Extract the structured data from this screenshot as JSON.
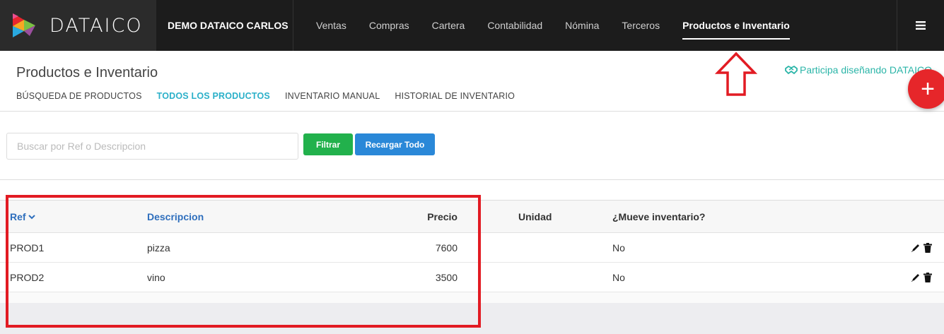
{
  "header": {
    "brand": "DATAICO",
    "company": "DEMO DATAICO CARLOS",
    "nav": [
      {
        "label": "Ventas"
      },
      {
        "label": "Compras"
      },
      {
        "label": "Cartera"
      },
      {
        "label": "Contabilidad"
      },
      {
        "label": "Nómina"
      },
      {
        "label": "Terceros"
      },
      {
        "label": "Productos e Inventario",
        "active": true
      }
    ],
    "menu_icon": "hamburger-icon"
  },
  "page": {
    "title": "Productos e Inventario",
    "participa": "Participa diseñando DATAICO",
    "tabs": [
      {
        "label": "BÚSQUEDA DE PRODUCTOS"
      },
      {
        "label": "TODOS LOS PRODUCTOS",
        "active": true
      },
      {
        "label": "INVENTARIO MANUAL"
      },
      {
        "label": "HISTORIAL DE INVENTARIO"
      }
    ]
  },
  "search": {
    "placeholder": "Buscar por Ref o Descripcion",
    "value": "",
    "filter_label": "Filtrar",
    "reload_label": "Recargar Todo"
  },
  "fab": {
    "label": "+"
  },
  "table": {
    "columns": [
      "Ref",
      "Descripcion",
      "Precio",
      "Unidad",
      "¿Mueve inventario?"
    ],
    "rows": [
      {
        "ref": "PROD1",
        "descripcion": "pizza",
        "precio": "7600",
        "unidad": "",
        "mueve": "No"
      },
      {
        "ref": "PROD2",
        "descripcion": "vino",
        "precio": "3500",
        "unidad": "",
        "mueve": "No"
      }
    ]
  },
  "colors": {
    "navbar": "#1c1c1c",
    "active_tab": "#2bb0c9",
    "filter_button": "#22b14c",
    "reload_button": "#2a88d8",
    "fab": "#e6262a",
    "annotation": "#e21b23"
  }
}
